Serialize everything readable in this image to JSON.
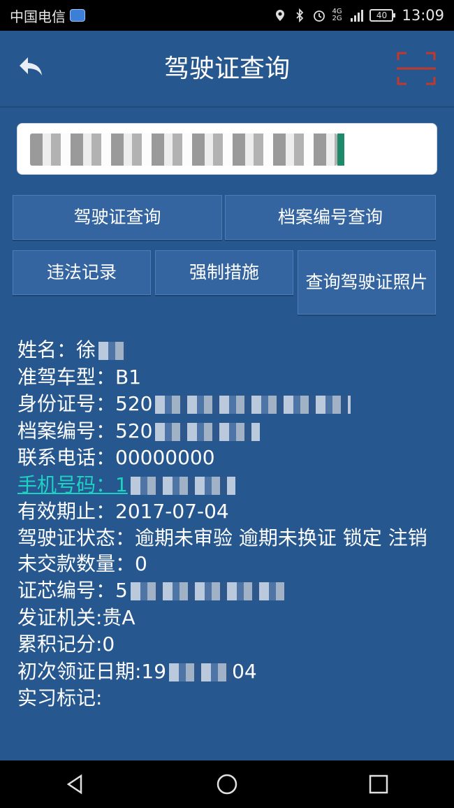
{
  "status_bar": {
    "carrier": "中国电信",
    "signal_label": "4G 2G",
    "battery": "40",
    "time": "13:09"
  },
  "header": {
    "title": "驾驶证查询"
  },
  "search": {
    "value": ""
  },
  "buttons": {
    "license_query": "驾驶证查询",
    "archive_query": "档案编号查询",
    "violation": "违法记录",
    "force_measures": "强制措施",
    "photo_query": "查询驾驶证照片"
  },
  "info": {
    "name": "姓名：徐",
    "vehicle_type": "准驾车型：B1",
    "id_number": "身份证号：520",
    "archive_number": "档案编号：520",
    "contact_phone": "联系电话：00000000",
    "mobile": "手机号码：1",
    "valid_until": "有效期止：2017-07-04",
    "license_status": "驾驶证状态：逾期未审验 逾期未换证 锁定 注销",
    "unpaid_count": "未交款数量：0",
    "chip_number": "证芯编号：5",
    "issuing_authority": "发证机关:贵A",
    "points": "累积记分:0",
    "first_issue_date_prefix": "初次领证日期:19",
    "first_issue_date_suffix": "04",
    "intern_mark": "实习标记:"
  },
  "colors": {
    "background": "#27578f",
    "button": "#3565a0",
    "phone_link": "#1fd1c2",
    "scan_icon": "#c0392b"
  }
}
